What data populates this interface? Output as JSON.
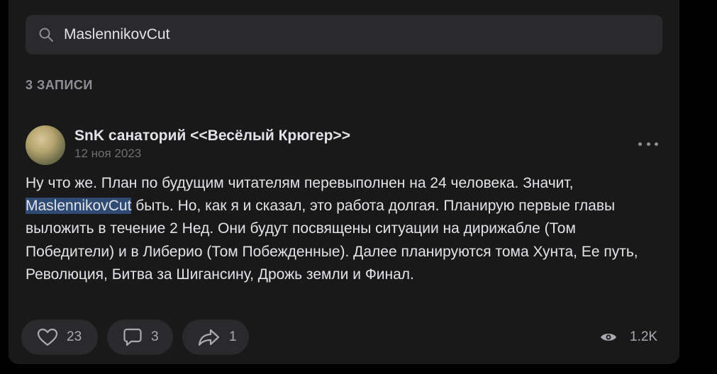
{
  "search": {
    "value": "MaslennikovCut",
    "icon": "search-icon"
  },
  "results": {
    "count_label": "3 ЗАПИСИ"
  },
  "post": {
    "author": "SnK санаторий <<Весёлый Крюгер>>",
    "date": "12 ноя 2023",
    "text_before": "Ну что же. План по будущим читателям перевыполнен на 24 человека. Значит, ",
    "highlight": "MaslennikovCut",
    "text_after": " быть. Но, как я и сказал, это работа долгая. Планирую первые главы выложить в течение 2 Нед. Они будут посвящены ситуации на дирижабле (Том Победители) и в Либерио (Том Побежденные). Далее планируются тома Хунта, Ее путь, Революция, Битва за Шигансину, Дрожь земли и Финал.",
    "likes": "23",
    "comments": "3",
    "shares": "1",
    "views": "1.2K"
  }
}
